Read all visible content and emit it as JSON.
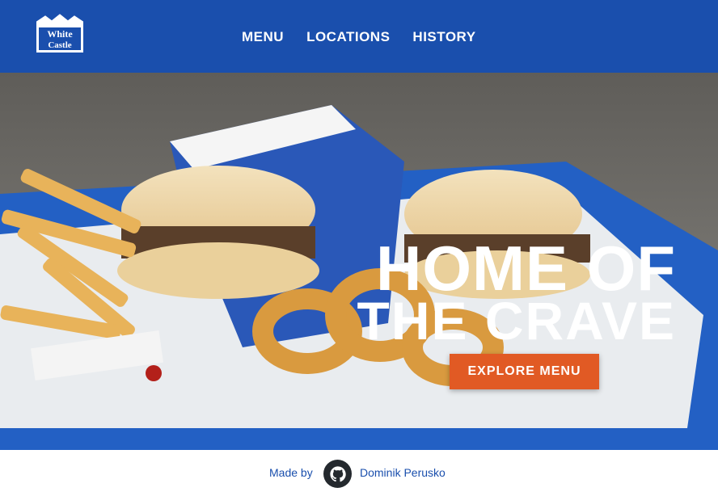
{
  "header": {
    "logo_text": "White Castle",
    "nav": [
      {
        "label": "MENU"
      },
      {
        "label": "LOCATIONS"
      },
      {
        "label": "HISTORY"
      }
    ]
  },
  "hero": {
    "title_line1": "HOME OF",
    "title_line2": "THE CRAVE",
    "cta_label": "EXPLORE MENU"
  },
  "footer": {
    "made_by": "Made by",
    "author": "Dominik Perusko",
    "icon": "github-icon"
  },
  "colors": {
    "brand_blue": "#1a4fad",
    "cta_orange": "#e15a24"
  }
}
